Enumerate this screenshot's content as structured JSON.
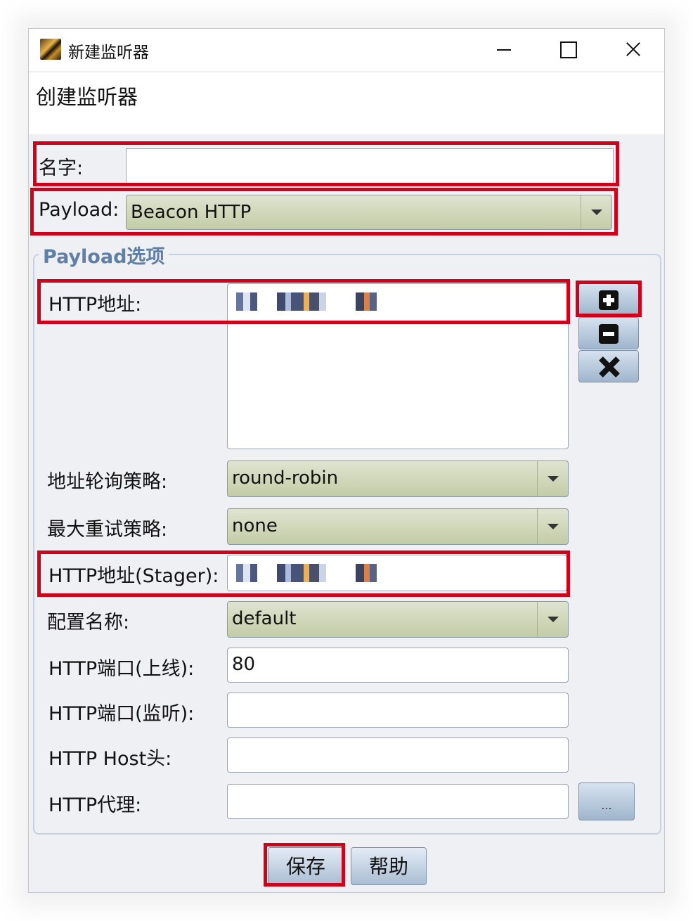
{
  "window": {
    "title": "新建监听器"
  },
  "header": {
    "title": "创建监听器"
  },
  "form": {
    "name_label": "名字:",
    "name_value": "",
    "payload_label": "Payload:",
    "payload_value": "Beacon HTTP"
  },
  "payload_options": {
    "group_title": "Payload选项",
    "http_address_label": "HTTP地址:",
    "rotation_label": "地址轮询策略:",
    "rotation_value": "round-robin",
    "retry_label": "最大重试策略:",
    "retry_value": "none",
    "stager_label": "HTTP地址(Stager):",
    "profile_label": "配置名称:",
    "profile_value": "default",
    "port_callback_label": "HTTP端口(上线):",
    "port_callback_value": "80",
    "port_bind_label": "HTTP端口(监听):",
    "port_bind_value": "",
    "host_header_label": "HTTP Host头:",
    "host_header_value": "",
    "proxy_label": "HTTP代理:",
    "proxy_value": "",
    "proxy_button_label": "..."
  },
  "buttons": {
    "save": "保存",
    "help": "帮助"
  },
  "icons": {
    "add": "plus-square-icon",
    "remove": "minus-square-icon",
    "clear": "x-icon"
  },
  "colors": {
    "highlight": "#d0021b",
    "group_title": "#5f7fa6",
    "combo_fill": "#cfd7b8"
  }
}
